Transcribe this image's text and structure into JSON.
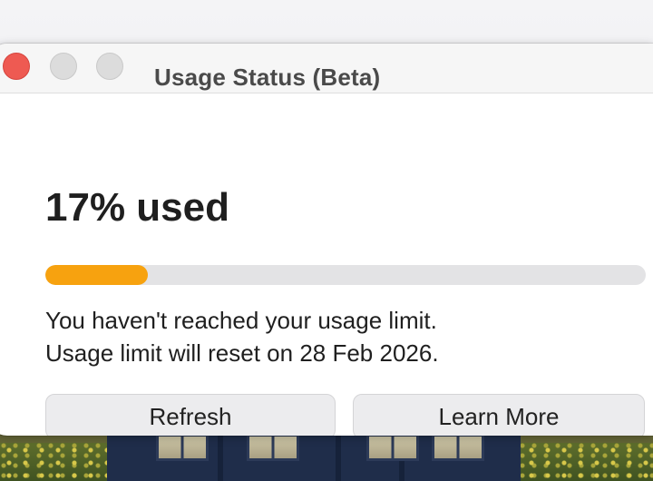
{
  "window": {
    "title": "Usage Status (Beta)"
  },
  "usage": {
    "percent_label": "17% used",
    "progress_fraction": 0.17,
    "status_message": "You haven't reached your usage limit.",
    "reset_message": "Usage limit will reset on 28 Feb 2026."
  },
  "buttons": {
    "refresh_label": "Refresh",
    "learn_more_label": "Learn More"
  },
  "colors": {
    "progress_fill": "#f7a20f",
    "close_button": "#ee5a52"
  }
}
